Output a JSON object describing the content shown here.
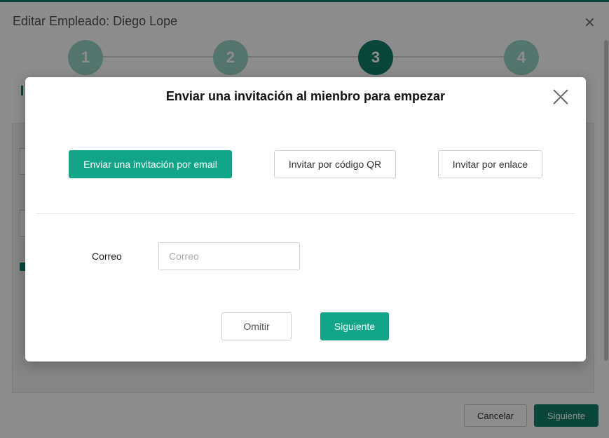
{
  "base": {
    "title": "Editar Empleado: Diego Lope",
    "close_icon": "close-icon",
    "steps": [
      "1",
      "2",
      "3",
      "4"
    ],
    "active_step": 3,
    "footer": {
      "cancel_label": "Cancelar",
      "next_label": "Siguiente"
    }
  },
  "modal": {
    "title": "Enviar una invitación al mienbro para empezar",
    "close_icon": "close-icon",
    "options": {
      "email_label": "Enviar una invitación por email",
      "qr_label": "Invitar por código QR",
      "link_label": "Invitar por enlace",
      "selected": "email"
    },
    "email_field": {
      "label": "Correo",
      "placeholder": "Correo",
      "value": ""
    },
    "footer": {
      "skip_label": "Omitir",
      "next_label": "Siguiente"
    }
  },
  "colors": {
    "accent": "#13a587",
    "accent_dark": "#13826a",
    "step_inactive": "#9ad5c6"
  }
}
